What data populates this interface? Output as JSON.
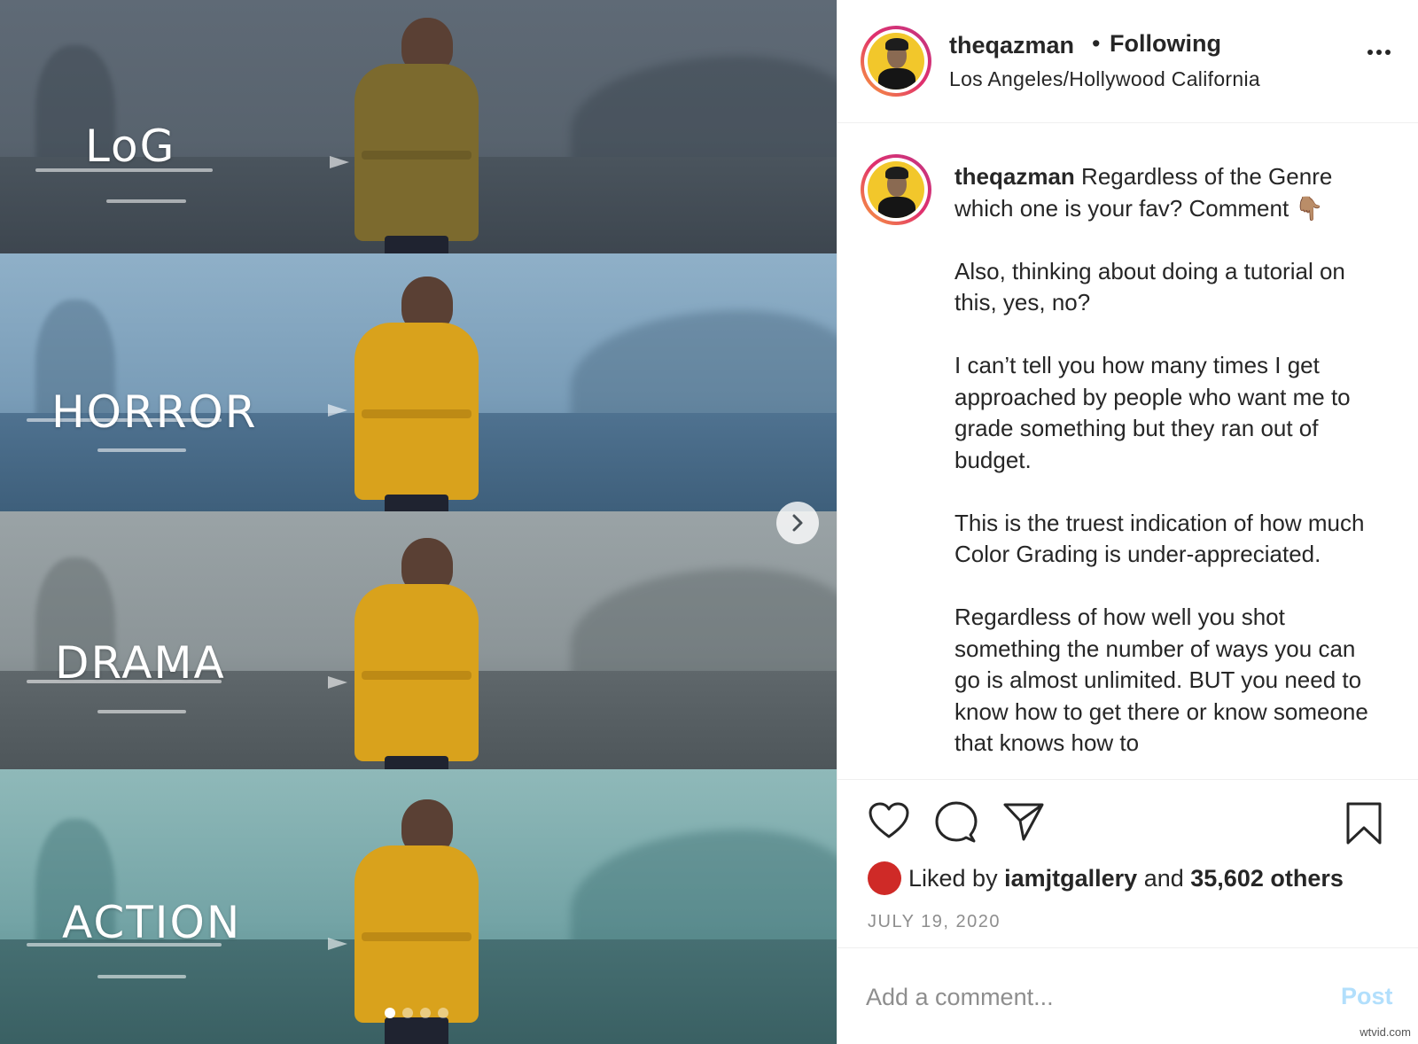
{
  "media": {
    "labels": [
      "LoG",
      "HORROR",
      "DRAMA",
      "ACTION"
    ],
    "carousel_dots": 4,
    "active_dot": 0,
    "colors": {
      "log": "#4e5b66",
      "horror": "#5f87a6",
      "drama": "#7d8a90",
      "action": "#5f9a9c",
      "coat_log": "#7c6a2e",
      "coat_color": "#d9a21c"
    }
  },
  "header": {
    "username": "theqazman",
    "separator": "•",
    "follow_status": "Following",
    "location": "Los Angeles/Hollywood California"
  },
  "caption": {
    "username": "theqazman",
    "text_first": "Regardless of the Genre which one is your fav? Comment 👇🏽",
    "paragraphs": [
      "Also, thinking about doing a tutorial on this, yes, no?",
      "I can’t tell you how many times I get approached by people who want me to grade something but they ran out of budget.",
      "This is the truest indication of how much Color Grading is under-appreciated.",
      "Regardless of how well you shot something the number of ways you can go is almost unlimited. BUT you need to know how to get there or know someone that knows how to"
    ]
  },
  "actions": {
    "icons": [
      "heart-icon",
      "comment-icon",
      "share-icon",
      "bookmark-icon"
    ],
    "liked_by_prefix": "Liked by",
    "liked_by_user": "iamjtgallery",
    "and_text": "and",
    "others_text": "35,602 others",
    "date": "JULY 19, 2020"
  },
  "comment": {
    "placeholder": "Add a comment...",
    "post_label": "Post"
  },
  "watermark": "wtvid.com"
}
